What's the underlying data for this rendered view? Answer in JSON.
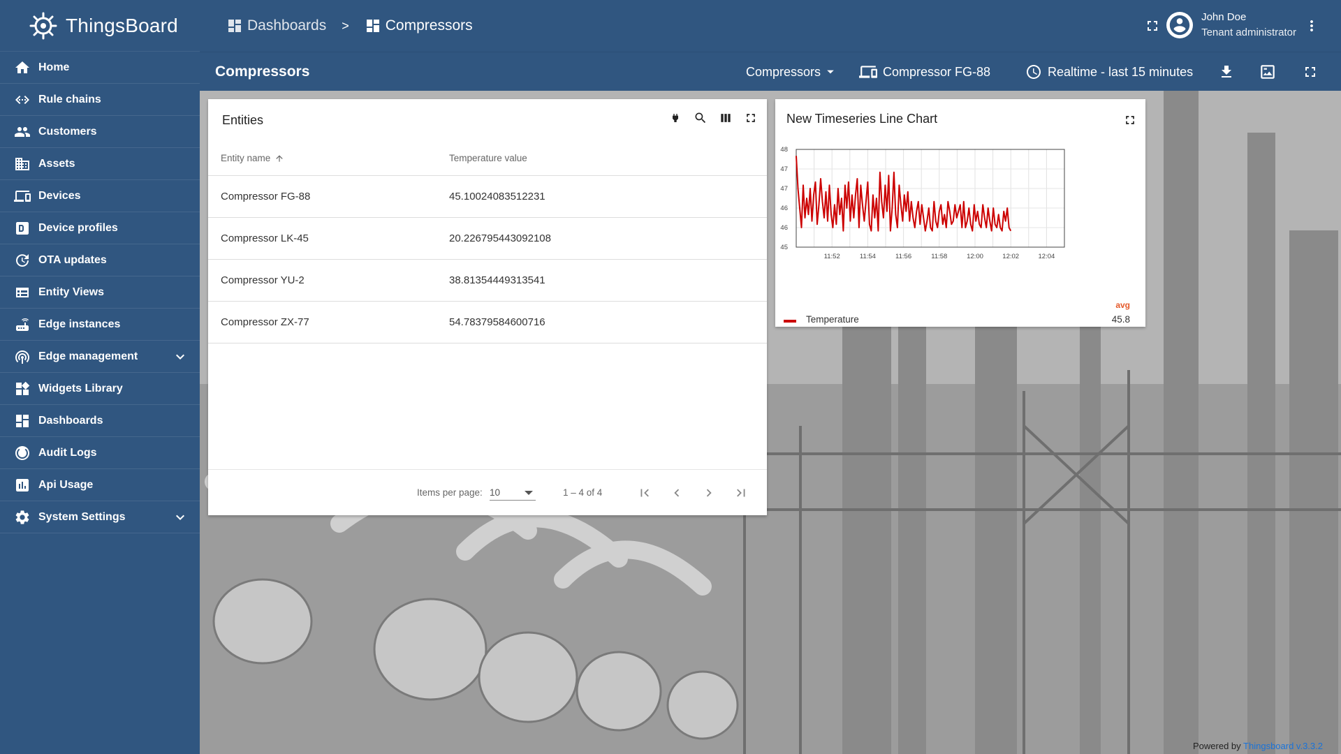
{
  "app": {
    "name": "ThingsBoard"
  },
  "sidebar": {
    "items": [
      {
        "label": "Home",
        "icon": "home-icon"
      },
      {
        "label": "Rule chains",
        "icon": "rule-chains-icon"
      },
      {
        "label": "Customers",
        "icon": "customers-icon"
      },
      {
        "label": "Assets",
        "icon": "assets-icon"
      },
      {
        "label": "Devices",
        "icon": "devices-icon"
      },
      {
        "label": "Device profiles",
        "icon": "device-profiles-icon"
      },
      {
        "label": "OTA updates",
        "icon": "ota-icon"
      },
      {
        "label": "Entity Views",
        "icon": "entity-views-icon"
      },
      {
        "label": "Edge instances",
        "icon": "edge-instances-icon"
      },
      {
        "label": "Edge management",
        "icon": "edge-management-icon",
        "expandable": true
      },
      {
        "label": "Widgets Library",
        "icon": "widgets-icon"
      },
      {
        "label": "Dashboards",
        "icon": "dashboards-icon"
      },
      {
        "label": "Audit Logs",
        "icon": "audit-logs-icon"
      },
      {
        "label": "Api Usage",
        "icon": "api-usage-icon"
      },
      {
        "label": "System Settings",
        "icon": "settings-icon",
        "expandable": true
      }
    ]
  },
  "header": {
    "breadcrumb": [
      "Dashboards",
      ">",
      "Compressors"
    ],
    "user": {
      "name": "John Doe",
      "role": "Tenant administrator"
    }
  },
  "toolbar": {
    "title": "Compressors",
    "state_select": "Compressors",
    "entity": "Compressor FG-88",
    "timewindow": "Realtime - last 15 minutes"
  },
  "entities_widget": {
    "title": "Entities",
    "columns": [
      "Entity name",
      "Temperature value"
    ],
    "rows": [
      {
        "name": "Compressor FG-88",
        "value": "45.10024083512231"
      },
      {
        "name": "Compressor LK-45",
        "value": "20.226795443092108"
      },
      {
        "name": "Compressor YU-2",
        "value": "38.81354449313541"
      },
      {
        "name": "Compressor ZX-77",
        "value": "54.78379584600716"
      }
    ],
    "pager": {
      "items_per_page_label": "Items per page:",
      "items_per_page": "10",
      "range": "1 – 4 of 4"
    }
  },
  "chart_widget": {
    "title": "New Timeseries Line Chart",
    "legend": {
      "header": "avg",
      "name": "Temperature",
      "avg": "45.8"
    }
  },
  "chart_data": {
    "type": "line",
    "title": "New Timeseries Line Chart",
    "xlabel": "",
    "ylabel": "",
    "x_ticks": [
      "11:52",
      "11:54",
      "11:56",
      "11:58",
      "12:00",
      "12:02",
      "12:04"
    ],
    "y_ticks": [
      "48",
      "47",
      "47",
      "46",
      "46",
      "45"
    ],
    "ylim": [
      45,
      48
    ],
    "x_range": [
      "11:50",
      "12:05"
    ],
    "grid": true,
    "legend_placement": "bottom",
    "series": [
      {
        "name": "Temperature",
        "color": "#cc0000",
        "start_time": "11:50",
        "end_time": "12:02",
        "values": [
          47.8,
          46.8,
          46.2,
          45.6,
          46.9,
          45.9,
          46.5,
          46.0,
          46.8,
          45.8,
          46.6,
          47.0,
          45.7,
          46.3,
          47.1,
          46.4,
          45.9,
          46.7,
          45.8,
          46.9,
          46.0,
          45.6,
          46.3,
          45.7,
          46.8,
          46.0,
          46.5,
          45.5,
          46.9,
          46.2,
          47.0,
          45.8,
          46.6,
          45.9,
          46.6,
          47.1,
          45.6,
          46.9,
          46.3,
          45.8,
          46.4,
          47.0,
          45.7,
          45.5,
          46.6,
          45.9,
          46.5,
          45.5,
          47.3,
          46.4,
          45.9,
          46.9,
          46.1,
          47.2,
          45.5,
          46.2,
          47.3,
          46.0,
          45.6,
          46.9,
          46.3,
          45.8,
          46.6,
          46.1,
          46.7,
          45.8,
          46.4,
          45.9,
          45.6,
          46.1,
          46.4,
          45.7,
          46.3,
          45.9,
          45.5,
          45.8,
          46.2,
          45.6,
          45.5,
          46.4,
          45.8,
          45.6,
          46.1,
          46.3,
          45.7,
          46.0,
          45.6,
          46.4,
          46.1,
          45.7,
          45.8,
          46.3,
          45.9,
          46.1,
          46.3,
          45.6,
          46.4,
          45.6,
          45.8,
          46.2,
          45.7,
          45.5,
          46.3,
          45.8,
          46.1,
          45.7,
          45.6,
          46.3,
          45.9,
          45.6,
          46.2,
          45.8,
          45.5,
          46.2,
          45.7,
          45.6,
          46.0,
          45.6,
          45.5,
          46.1,
          45.8,
          46.2,
          45.6,
          45.5
        ]
      }
    ]
  },
  "footer": {
    "powered_by": "Powered by",
    "link": "Thingsboard v.3.3.2"
  }
}
